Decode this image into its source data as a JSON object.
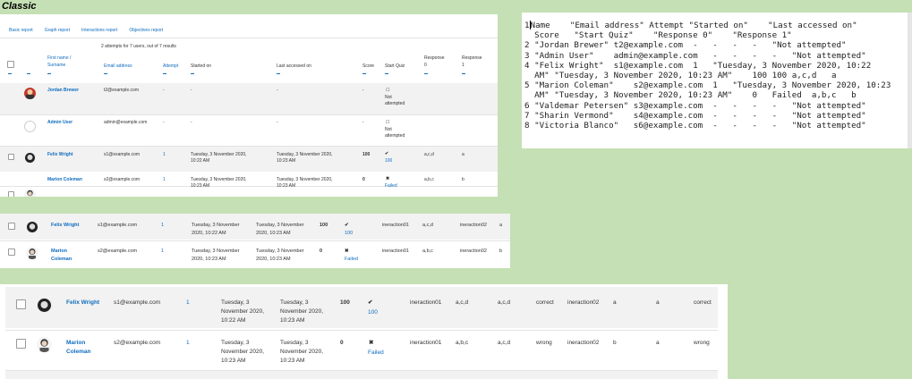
{
  "heading": "Classic",
  "panel1": {
    "tabs": [
      "Basic report",
      "Graph report",
      "Interactions report",
      "Objectives report"
    ],
    "summary": "2 attempts for 7 users, out of 7 results",
    "headers": {
      "name": [
        "First name /",
        "Surname"
      ],
      "email": "Email address",
      "attempt": "Attempt",
      "started": "Started on",
      "accessed": "Last accessed on",
      "score": "Score",
      "start_quiz": "Start Quiz",
      "resp0": [
        "Response",
        "0"
      ],
      "resp1": [
        "Response",
        "1"
      ]
    },
    "rows": [
      {
        "name": "Jordan Brewer",
        "email": "t2@example.com",
        "attempt": "-",
        "started": "-",
        "accessed": "-",
        "score": "-",
        "status_icon": "square-icon",
        "status": [
          "Not",
          "attempted"
        ],
        "r0": "",
        "r1": ""
      },
      {
        "name": "Admin User",
        "email": "admin@example.com",
        "attempt": "-",
        "started": "-",
        "accessed": "-",
        "score": "-",
        "status_icon": "square-icon",
        "status": [
          "Not",
          "attempted"
        ],
        "r0": "",
        "r1": ""
      },
      {
        "name": "Felix Wright",
        "email": "s1@example.com",
        "attempt": "1",
        "started": [
          "Tuesday, 3 November 2020,",
          "10:22 AM"
        ],
        "accessed": [
          "Tuesday, 3 November 2020,",
          "10:23 AM"
        ],
        "score": "100",
        "status_icon": "check-icon",
        "status": [
          "100"
        ],
        "r0": "a,c,d",
        "r1": "a"
      },
      {
        "name": "Marion Coleman",
        "email": "s2@example.com",
        "attempt": "1",
        "started": [
          "Tuesday, 3 November 2020,",
          "10:23 AM"
        ],
        "accessed": [
          "Tuesday, 3 November 2020,",
          "10:23 AM"
        ],
        "score": "0",
        "status_icon": "cross-icon",
        "status": [
          "Failed"
        ],
        "r0": "a,b,c",
        "r1": "b"
      }
    ]
  },
  "panel2": {
    "rows": [
      {
        "name": "Felix Wright",
        "email": "s1@example.com",
        "attempt": "1",
        "started": [
          "Tuesday, 3 November",
          "2020, 10:22 AM"
        ],
        "accessed": [
          "Tuesday, 3 November",
          "2020, 10:23 AM"
        ],
        "score": "100",
        "status": "100",
        "i1": "ineraction01",
        "r1": "a,c,d",
        "i2": "ineraction02",
        "r2": "a"
      },
      {
        "name": [
          "Marion",
          "Coleman"
        ],
        "email": "s2@example.com",
        "attempt": "1",
        "started": [
          "Tuesday, 3 November",
          "2020, 10:23 AM"
        ],
        "accessed": [
          "Tuesday, 3 November",
          "2020, 10:23 AM"
        ],
        "score": "0",
        "status": "Failed",
        "i1": "ineraction01",
        "r1": "a,b,c",
        "i2": "ineraction02",
        "r2": "b"
      }
    ]
  },
  "panel3": {
    "rows": [
      {
        "name": "Felix Wright",
        "email": "s1@example.com",
        "attempt": "1",
        "started": [
          "Tuesday, 3",
          "November 2020,",
          "10:22 AM"
        ],
        "accessed": [
          "Tuesday, 3",
          "November 2020,",
          "10:23 AM"
        ],
        "score": "100",
        "status": "100",
        "i1": "ineraction01",
        "r1": "a,c,d",
        "c1": "a,c,d",
        "res1": "correct",
        "i2": "ineraction02",
        "r2": "a",
        "c2": "a",
        "res2": "correct"
      },
      {
        "name": [
          "Marion",
          "Coleman"
        ],
        "email": "s2@example.com",
        "attempt": "1",
        "started": [
          "Tuesday, 3",
          "November 2020,",
          "10:23 AM"
        ],
        "accessed": [
          "Tuesday, 3",
          "November 2020,",
          "10:23 AM"
        ],
        "score": "0",
        "status": "Failed",
        "i1": "ineraction01",
        "r1": "a,b,c",
        "c1": "a,c,d",
        "res1": "wrong",
        "i2": "ineraction02",
        "r2": "b",
        "c2": "a",
        "res2": "wrong"
      }
    ]
  },
  "csv": {
    "lines": [
      {
        "n": "1",
        "text": "Name    \"Email address\" Attempt \"Started on\"    \"Last accessed on\""
      },
      {
        "n": "",
        "text": "Score   \"Start Quiz\"    \"Response 0\"    \"Response 1\""
      },
      {
        "n": "2",
        "text": "\"Jordan Brewer\" t2@example.com  -   -   -   -   \"Not attempted\""
      },
      {
        "n": "3",
        "text": "\"Admin User\"    admin@example.com   -   -   -   -   \"Not attempted\""
      },
      {
        "n": "4",
        "text": "\"Felix Wright\"  s1@example.com  1   \"Tuesday, 3 November 2020, 10:22"
      },
      {
        "n": "",
        "text": "AM\" \"Tuesday, 3 November 2020, 10:23 AM\"    100 100 a,c,d   a"
      },
      {
        "n": "5",
        "text": "\"Marion Coleman\"    s2@example.com  1   \"Tuesday, 3 November 2020, 10:23"
      },
      {
        "n": "",
        "text": "AM\" \"Tuesday, 3 November 2020, 10:23 AM\"    0   Failed  a,b,c   b"
      },
      {
        "n": "6",
        "text": "\"Valdemar Petersen\" s3@example.com  -   -   -   -   \"Not attempted\""
      },
      {
        "n": "7",
        "text": "\"Sharin Vermond\"    s4@example.com  -   -   -   -   \"Not attempted\""
      },
      {
        "n": "8",
        "text": "\"Victoria Blanco\"   s6@example.com  -   -   -   -   \"Not attempted\""
      }
    ]
  },
  "colors": {
    "link": "#0f6cbf",
    "background": "#c5e0b4",
    "shaded_row": "#f2f2f2"
  }
}
